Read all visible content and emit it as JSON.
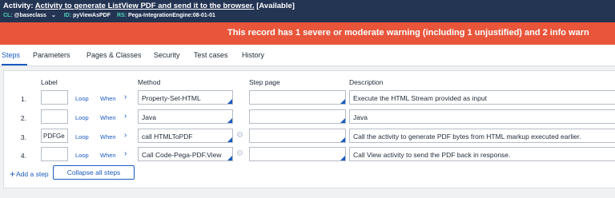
{
  "header": {
    "type_label": "Activity:",
    "title": "Activity to generate ListView PDF and send it to the browser.",
    "status": "[Available]",
    "class_key": "CL:",
    "class_value": "@baseclass",
    "id_key": "ID:",
    "id_value": "pyViewAsPDF",
    "rs_key": "RS:",
    "rs_value": "Pega-IntegrationEngine:08-01-01"
  },
  "warning": {
    "text": "This record has 1 severe or moderate warning (including 1 unjustified) and 2 info warn"
  },
  "tabs": [
    {
      "label": "Steps"
    },
    {
      "label": "Parameters"
    },
    {
      "label": "Pages & Classes"
    },
    {
      "label": "Security"
    },
    {
      "label": "Test cases"
    },
    {
      "label": "History"
    }
  ],
  "columns": {
    "label": "Label",
    "method": "Method",
    "step_page": "Step page",
    "description": "Description"
  },
  "steps": [
    {
      "num": "1.",
      "label": "",
      "loop": "Loop",
      "when": "When",
      "method": "Property-Set-HTML",
      "step_page": "",
      "description": "Execute the HTML Stream provided as input"
    },
    {
      "num": "2.",
      "label": "",
      "loop": "Loop",
      "when": "When",
      "method": "Java",
      "step_page": "",
      "description": "Java"
    },
    {
      "num": "3.",
      "label": "PDFGe",
      "loop": "Loop",
      "when": "When",
      "method": "call HTMLToPDF",
      "step_page": "",
      "description": "Call the activity to generate PDF bytes from HTML markup executed earlier."
    },
    {
      "num": "4.",
      "label": "",
      "loop": "Loop",
      "when": "When",
      "method": "Call Code-Pega-PDF.View",
      "step_page": "",
      "description": "Call View activity to send the PDF back in response."
    }
  ],
  "actions": {
    "add_step": "Add a step",
    "collapse_all": "Collapse all steps"
  },
  "icons": {
    "chevron": "chevron-right-icon",
    "gear": "gear-icon",
    "plus": "plus-icon",
    "dropdown": "chevron-down-icon"
  },
  "colors": {
    "header_bg": "#243453",
    "warning_bg": "#e8553a",
    "accent": "#1a5bbf",
    "meta_key": "#4fd0b8"
  }
}
